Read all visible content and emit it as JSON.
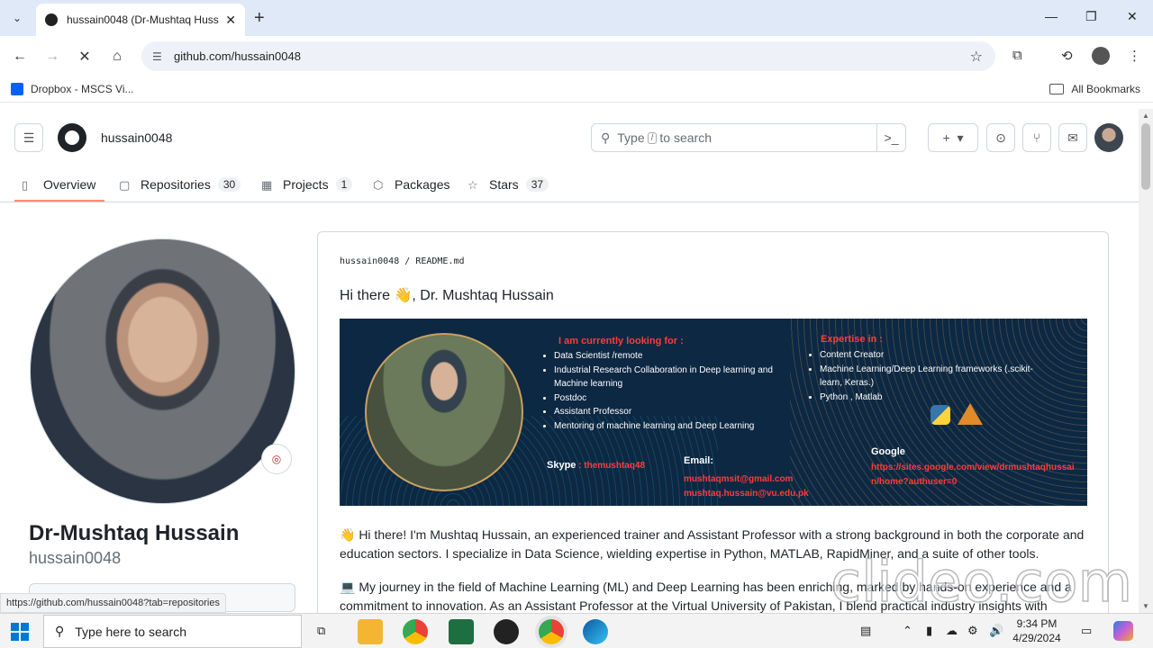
{
  "browser": {
    "tab_title": "hussain0048 (Dr-Mushtaq Huss",
    "url": "github.com/hussain0048",
    "bookmark_dropbox": "Dropbox - MSCS Vi...",
    "bookmark_all": "All Bookmarks",
    "status_url": "https://github.com/hussain0048?tab=repositories"
  },
  "github": {
    "header_username": "hussain0048",
    "search_prefix": "Type",
    "search_key": "/",
    "search_suffix": "to search",
    "tabs": [
      {
        "label": "Overview"
      },
      {
        "label": "Repositories",
        "count": "30"
      },
      {
        "label": "Projects",
        "count": "1"
      },
      {
        "label": "Packages"
      },
      {
        "label": "Stars",
        "count": "37"
      }
    ],
    "profile": {
      "full_name": "Dr-Mushtaq Hussain",
      "login": "hussain0048"
    },
    "readme": {
      "path_user": "hussain0048",
      "path_sep": "/",
      "path_file": "README.md",
      "heading": "Hi there 👋, Dr. Mushtaq Hussain",
      "banner": {
        "looking_heading": "I am currently looking for :",
        "looking_items": [
          "Data Scientist /remote",
          "Industrial Research Collaboration in Deep learning and Machine learning",
          "Postdoc",
          "Assistant Professor",
          "Mentoring of machine learning and Deep Learning"
        ],
        "expertise_heading": "Expertise in :",
        "expertise_items": [
          "Content Creator",
          "Machine Learning/Deep Learning frameworks (.scikit-learn, Keras.)",
          "Python , Matlab"
        ],
        "skype_label": "Skype",
        "skype_value": ": themushtaq48",
        "email_label": "Email:",
        "email_1": "mushtaqmsit@gmail.com",
        "email_2": "mushtaq.hussain@vu.edu.pk",
        "google_label": "Google",
        "google_url": "https://sites.google.com/view/drmushtaqhussain/home?authuser=0"
      },
      "para_1": "👋 Hi there! I'm Mushtaq Hussain, an experienced trainer and Assistant Professor with a strong background in both the corporate and education sectors. I specialize in Data Science, wielding expertise in Python, MATLAB, RapidMiner, and a suite of other tools.",
      "para_2": "💻 My journey in the field of Machine Learning (ML) and Deep Learning has been enriching, marked by hands-on experience and a commitment to innovation. As an Assistant Professor at the Virtual University of Pakistan, I blend practical industry insights with"
    }
  },
  "watermark": "clideo.com",
  "taskbar": {
    "search_placeholder": "Type here to search",
    "time": "9:34 PM",
    "date": "4/29/2024"
  },
  "colors": {
    "accent_underline": "#fd8c73",
    "banner_bg": "#0d2843",
    "banner_red": "#ff3b3b"
  }
}
